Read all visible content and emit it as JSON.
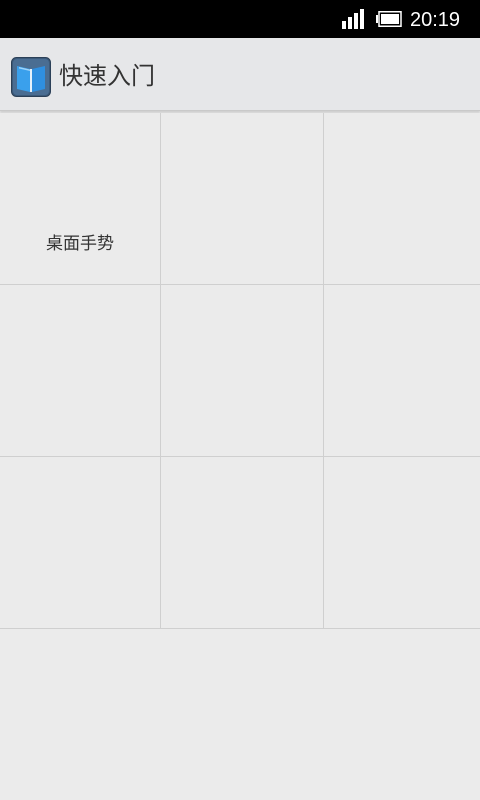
{
  "status_bar": {
    "time": "20:19",
    "signal_icon": "signal-bars-icon",
    "battery_icon": "battery-icon"
  },
  "action_bar": {
    "title": "快速入门",
    "app_icon": "book-icon"
  },
  "grid": {
    "cells": [
      {
        "label": "桌面手势"
      },
      {
        "label": ""
      },
      {
        "label": ""
      },
      {
        "label": ""
      },
      {
        "label": ""
      },
      {
        "label": ""
      },
      {
        "label": ""
      },
      {
        "label": ""
      },
      {
        "label": ""
      }
    ]
  },
  "colors": {
    "status_bar_bg": "#000000",
    "action_bar_bg": "#e6e7e9",
    "background": "#ebebeb",
    "grid_line": "#cfcfcf",
    "icon_blue": "#2f8fe0"
  }
}
